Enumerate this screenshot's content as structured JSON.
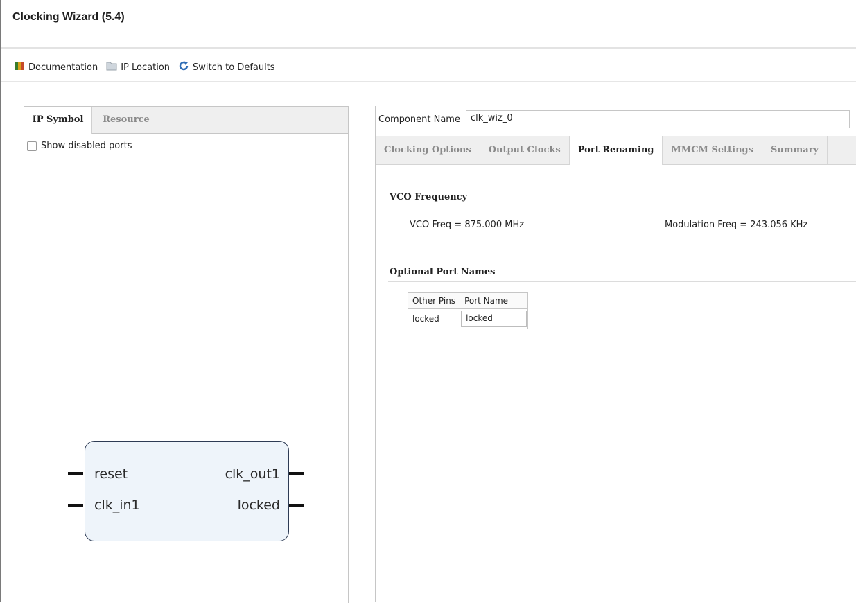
{
  "window": {
    "title": "Clocking Wizard (5.4)"
  },
  "toolbar": {
    "items": [
      {
        "label": "Documentation",
        "icon": "book-icon"
      },
      {
        "label": "IP Location",
        "icon": "folder-icon"
      },
      {
        "label": "Switch to Defaults",
        "icon": "refresh-icon"
      }
    ]
  },
  "left_panel": {
    "tabs": [
      {
        "label": "IP Symbol",
        "active": true
      },
      {
        "label": "Resource",
        "active": false
      }
    ],
    "show_disabled_ports": {
      "label": "Show disabled ports",
      "checked": false
    },
    "ip_symbol": {
      "inputs": [
        "reset",
        "clk_in1"
      ],
      "outputs": [
        "clk_out1",
        "locked"
      ]
    }
  },
  "right_panel": {
    "component_name": {
      "label": "Component Name",
      "value": "clk_wiz_0"
    },
    "tabs": [
      {
        "label": "Clocking Options",
        "active": false
      },
      {
        "label": "Output Clocks",
        "active": false
      },
      {
        "label": "Port Renaming",
        "active": true
      },
      {
        "label": "MMCM Settings",
        "active": false
      },
      {
        "label": "Summary",
        "active": false
      }
    ],
    "vco_frequency": {
      "title": "VCO Frequency",
      "vco_freq": "VCO Freq = 875.000 MHz",
      "modulation_freq": "Modulation Freq = 243.056 KHz"
    },
    "optional_port_names": {
      "title": "Optional Port Names",
      "columns": [
        "Other Pins",
        "Port Name"
      ],
      "rows": [
        {
          "pin": "locked",
          "port_name": "locked"
        }
      ]
    }
  },
  "colors": {
    "symbol_fill": "#eef4fa",
    "symbol_border": "#2e3b54",
    "tab_bar": "#efefef",
    "inactive_tab_text": "#8a8a8a"
  }
}
